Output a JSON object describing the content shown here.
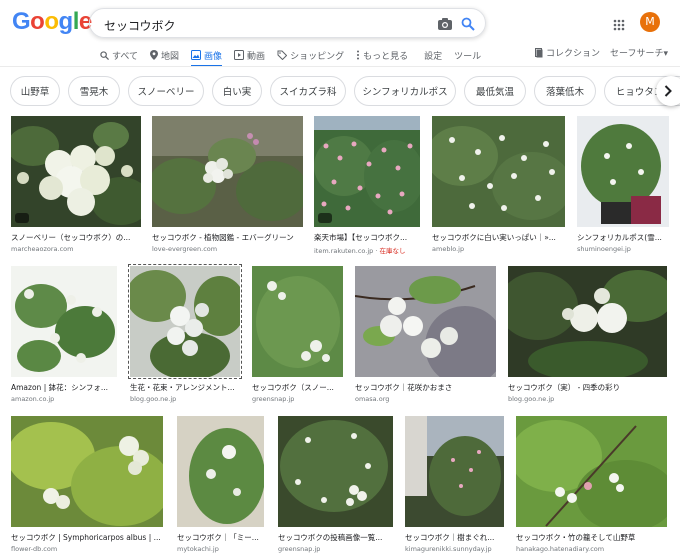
{
  "logo": {
    "letters": [
      "G",
      "o",
      "o",
      "g",
      "l",
      "e"
    ],
    "colors": [
      "#4285F4",
      "#EA4335",
      "#FBBC05",
      "#4285F4",
      "#34A853",
      "#EA4335"
    ]
  },
  "search": {
    "query": "セッコウボク"
  },
  "account": {
    "initial": "M"
  },
  "tabs": [
    {
      "label": "すべて",
      "icon": "search-icon"
    },
    {
      "label": "地図",
      "icon": "map-pin-icon"
    },
    {
      "label": "画像",
      "icon": "image-icon",
      "active": true
    },
    {
      "label": "動画",
      "icon": "video-icon"
    },
    {
      "label": "ショッピング",
      "icon": "tag-icon"
    },
    {
      "label": "もっと見る",
      "icon": "more-icon"
    },
    {
      "label": "設定"
    },
    {
      "label": "ツール"
    }
  ],
  "right_links": {
    "collection": "コレクション",
    "safesearch": "セーフサーチ▾"
  },
  "chips": [
    "山野草",
    "雪晃木",
    "スノーベリー",
    "白い実",
    "スイカズラ科",
    "シンフォリカルポス",
    "最低気温",
    "落葉低木",
    "ヒョウタンボク"
  ],
  "results": [
    {
      "caption": "スノーベリー（セッコウボク）の...",
      "source": "marcheaozora.com"
    },
    {
      "caption": "セッコウボク - 植物図鑑 - エバーグリーン",
      "source": "love-evergreen.com"
    },
    {
      "caption": "楽天市場】【セッコウボク...",
      "source": "item.rakuten.co.jp",
      "stock": "在庫なし"
    },
    {
      "caption": "セッコウボクに白い実いっぱい｜»...",
      "source": "ameblo.jp"
    },
    {
      "caption": "シンフォリカルポス(雪...",
      "source": "shuminoengei.jp"
    },
    {
      "caption": "Amazon | 鉢花：シンフォ...",
      "source": "amazon.co.jp"
    },
    {
      "caption": "生花・花束・アレンジメント...",
      "source": "blog.goo.ne.jp"
    },
    {
      "caption": "セッコウボク（スノー...",
      "source": "greensnap.jp"
    },
    {
      "caption": "セッコウボク｜花咲かおまさ",
      "source": "omasa.org"
    },
    {
      "caption": "セッコウボク（実） - 四季の彩り",
      "source": "blog.goo.ne.jp"
    },
    {
      "caption": "セッコウボク | Symphoricarpos albus | ...",
      "source": "flower-db.com"
    },
    {
      "caption": "セッコウボク｜「ミー...",
      "source": "mytokachi.jp"
    },
    {
      "caption": "セッコウボクの投稿画像一覧...",
      "source": "greensnap.jp"
    },
    {
      "caption": "セッコウボク｜樹まぐれ...",
      "source": "kimagurenikki.sunnyday.jp"
    },
    {
      "caption": "セッコウボク・竹の籠そして山野草",
      "source": "hanakago.hatenadiary.com"
    }
  ]
}
